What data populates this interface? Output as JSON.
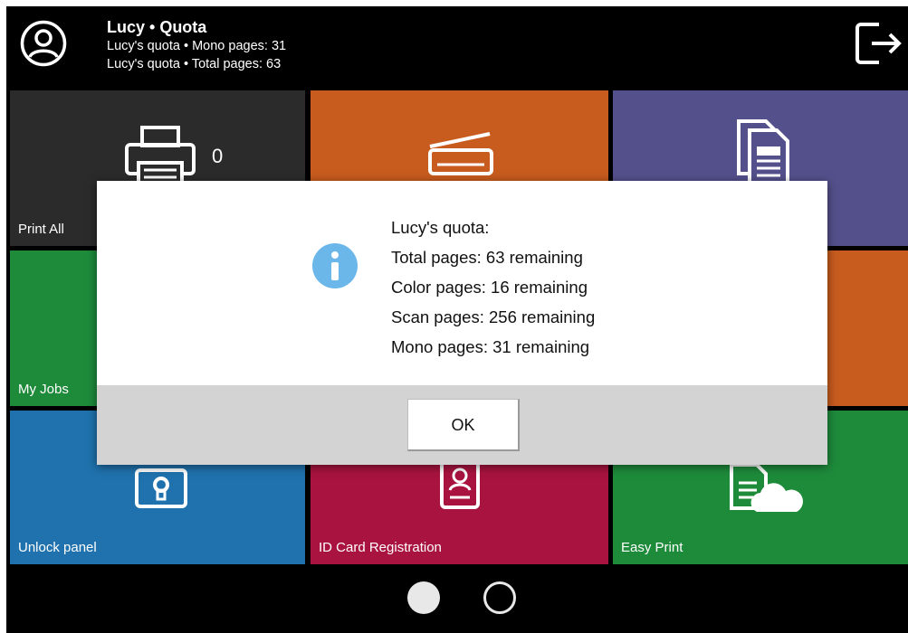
{
  "header": {
    "title": "Lucy • Quota",
    "lines": [
      "Lucy's quota • Mono pages: 31",
      "Lucy's quota • Total pages: 63"
    ],
    "avatar_icon": "user-avatar-icon",
    "logout_icon": "logout-icon"
  },
  "tiles": {
    "print_all": {
      "label": "Print All",
      "count": "0",
      "color": "#2b2b2b",
      "icon": "printer-icon"
    },
    "scan": {
      "label": "",
      "color": "#c85c1e",
      "icon": "scanner-icon"
    },
    "copy": {
      "label": "",
      "color": "#54508c",
      "icon": "copy-document-icon"
    },
    "my_jobs": {
      "label": "My Jobs",
      "color": "#1e8b3b"
    },
    "orange_tile": {
      "label": "",
      "color": "#c85c1e"
    },
    "unlock_panel": {
      "label": "Unlock panel",
      "color": "#1f72ad",
      "icon": "keyhole-lock-icon"
    },
    "id_card": {
      "label": "ID Card Registration",
      "color": "#a8133f",
      "icon": "id-card-icon"
    },
    "easy_print": {
      "label": "Easy Print",
      "color": "#1e8b3b",
      "icon": "cloud-document-icon"
    }
  },
  "pagination": {
    "pages": 2,
    "active_page": 1
  },
  "dialog": {
    "icon": "info-icon",
    "icon_color": "#6bb7ea",
    "lines": [
      "Lucy's quota:",
      "Total pages: 63 remaining",
      "Color pages: 16 remaining",
      "Scan pages: 256 remaining",
      "Mono pages: 31 remaining"
    ],
    "ok_label": "OK"
  }
}
